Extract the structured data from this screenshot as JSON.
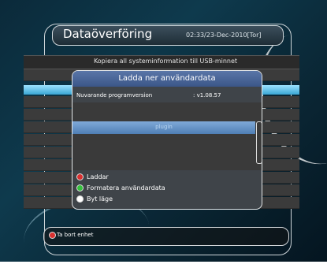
{
  "header": {
    "title": "Dataöverföring",
    "clock": "02:33/23-Dec-2010[Tor]"
  },
  "subtitle": "Kopiera all systeminformation till USB-minnet",
  "dialog": {
    "title": "Ladda ner användardata",
    "version_label": "Nuvarande programversion",
    "version_value": ": v1.08.57",
    "list_items": [
      "plugin"
    ],
    "options": [
      {
        "color": "#d93030",
        "label": "Laddar"
      },
      {
        "color": "#35c13d",
        "label": "Formatera användardata"
      },
      {
        "color": "#ffffff",
        "label": "Byt läge"
      }
    ]
  },
  "footer": {
    "label": "Ta bort enhet",
    "color": "#d93030"
  }
}
